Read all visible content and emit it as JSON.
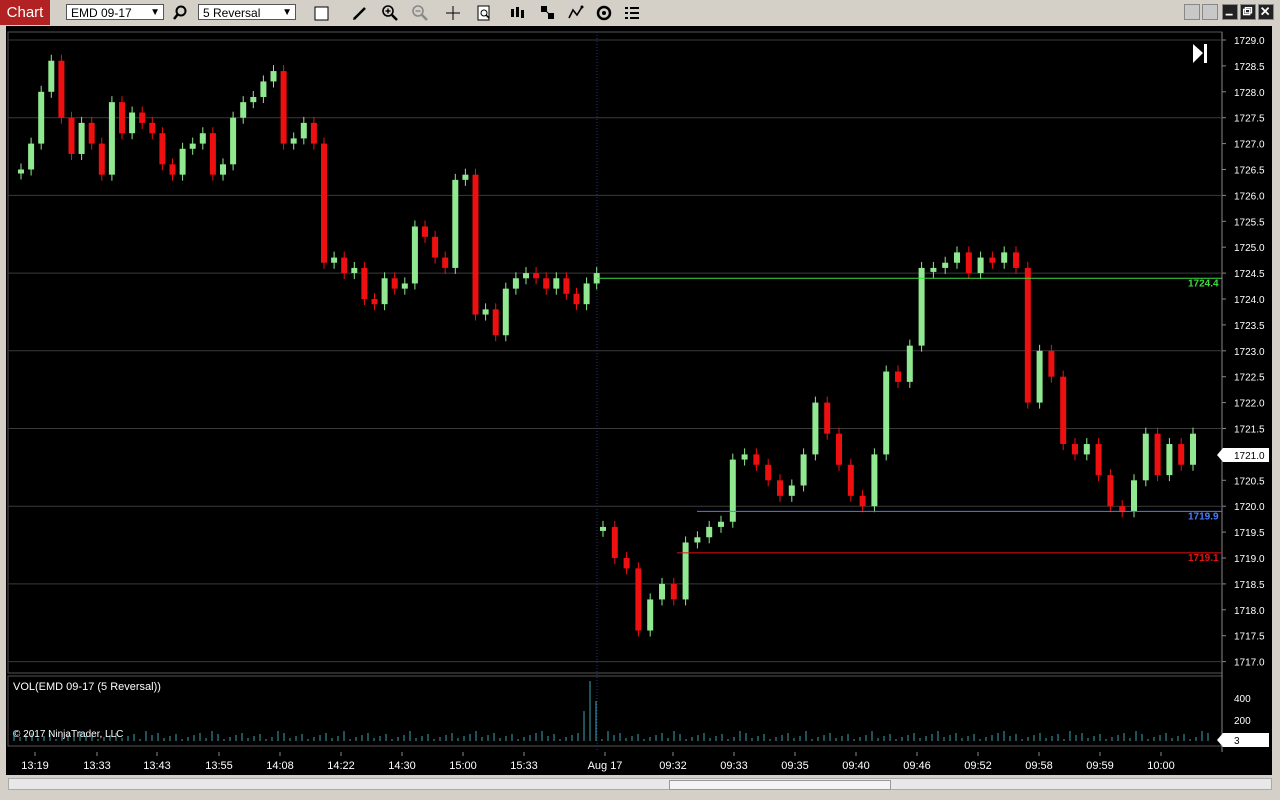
{
  "toolbar": {
    "tab_label": "Chart",
    "instrument": "EMD 09-17",
    "bar_type": "5 Reversal",
    "icons": [
      "search-icon",
      "blank-box-icon",
      "pencil-icon",
      "zoom-in-icon",
      "zoom-out-icon",
      "crosshair-icon",
      "data-box-icon",
      "bar-style-icon",
      "drawing-tools-icon",
      "indicators-icon",
      "strategies-icon",
      "properties-icon"
    ]
  },
  "window": {
    "buttons": [
      "minimize",
      "restore",
      "maximize",
      "close"
    ]
  },
  "chart": {
    "price_axis": {
      "labels": [
        "1729.0",
        "1728.5",
        "1728.0",
        "1727.5",
        "1727.0",
        "1726.5",
        "1726.0",
        "1725.5",
        "1725.0",
        "1724.5",
        "1724.0",
        "1723.5",
        "1723.0",
        "1722.5",
        "1722.0",
        "1721.5",
        "1721.0",
        "1720.5",
        "1720.0",
        "1719.5",
        "1719.0",
        "1718.5",
        "1718.0",
        "1717.5",
        "1717.0"
      ],
      "current_price": "1721.0"
    },
    "lines": [
      {
        "value": "1724.4",
        "color": "#3ddc3d"
      },
      {
        "value": "1719.9",
        "color": "#4a7dff"
      },
      {
        "value": "1719.1",
        "color": "#e81010"
      }
    ],
    "colors": {
      "up": "#90e890",
      "down": "#ee1010",
      "grid": "#3a3a3a",
      "volume": "#3aa6b0"
    },
    "time_axis": [
      "13:19",
      "13:33",
      "13:43",
      "13:55",
      "14:08",
      "14:22",
      "14:30",
      "15:00",
      "15:33",
      "Aug 17",
      "09:32",
      "09:33",
      "09:35",
      "09:40",
      "09:46",
      "09:52",
      "09:58",
      "09:59",
      "10:00"
    ]
  },
  "volume_panel": {
    "title": "VOL(EMD 09-17 (5 Reversal))",
    "copyright": "© 2017 NinjaTrader, LLC",
    "axis_labels": [
      "400",
      "200"
    ],
    "current_value": "3"
  }
}
